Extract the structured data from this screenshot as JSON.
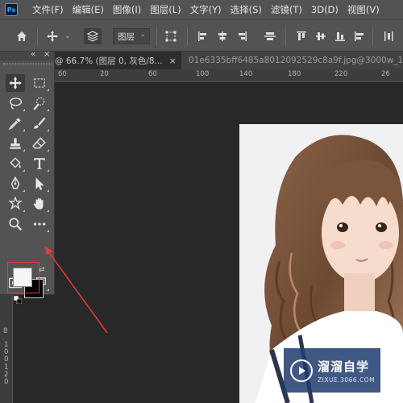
{
  "app": {
    "logo_text": "Ps"
  },
  "menu": [
    "文件(F)",
    "编辑(E)",
    "图像(I)",
    "图层(L)",
    "文字(Y)",
    "选择(S)",
    "滤镜(T)",
    "3D(D)",
    "视图(V)"
  ],
  "options_bar": {
    "layer_select_value": "图层"
  },
  "tabs": {
    "active_label": "@ 66.7% (图层 0, 灰色/8...",
    "close_label": "×",
    "second_label": "01e6335bff6485a8012092529c8a9f.jpg@3000w_1l_2"
  },
  "rulers": {
    "top_labels": [
      "60",
      "20",
      "60",
      "100",
      "140",
      "180",
      "220",
      "26"
    ],
    "left_labels": [
      "4",
      "8",
      "1\n0\n0",
      "1\n2\n0",
      "8",
      "1"
    ]
  },
  "toolbox": {
    "collapse_label": "«",
    "close_label": "×"
  },
  "colors": {
    "foreground": "#f5f5f5",
    "background": "#000000",
    "highlight": "#e23c3c",
    "arrow": "#e23c3c"
  },
  "watermark": {
    "title": "溜溜自学",
    "url": "ZIXUE.3066.COM"
  }
}
